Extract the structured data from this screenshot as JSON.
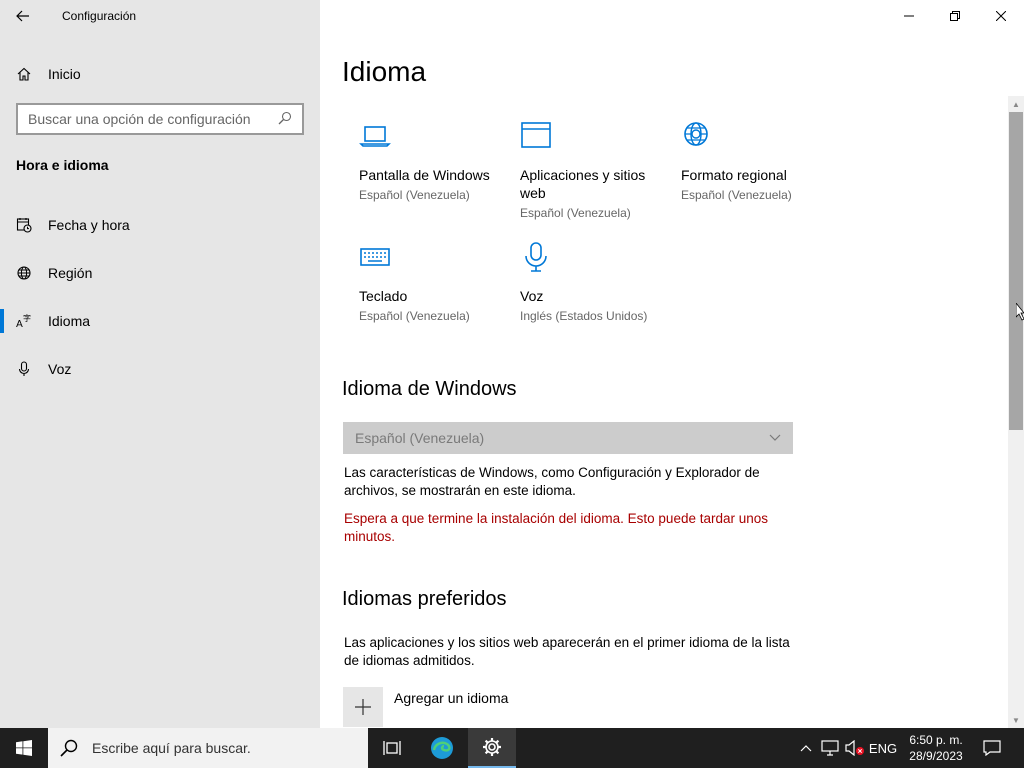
{
  "window": {
    "title": "Configuración",
    "controls": {
      "minimize": "—",
      "restore": "❐",
      "close": "✕"
    }
  },
  "sidebar": {
    "home_label": "Inicio",
    "search_placeholder": "Buscar una opción de configuración",
    "section_title": "Hora e idioma",
    "items": [
      {
        "label": "Fecha y hora",
        "icon": "calendar-clock-icon",
        "selected": false
      },
      {
        "label": "Región",
        "icon": "globe-icon",
        "selected": false
      },
      {
        "label": "Idioma",
        "icon": "language-icon",
        "selected": true
      },
      {
        "label": "Voz",
        "icon": "microphone-icon",
        "selected": false
      }
    ]
  },
  "main": {
    "title": "Idioma",
    "tiles": [
      {
        "title": "Pantalla de Windows",
        "subtitle": "Español (Venezuela)",
        "icon": "laptop-icon"
      },
      {
        "title": "Aplicaciones y sitios web",
        "subtitle": "Español (Venezuela)",
        "icon": "app-window-icon"
      },
      {
        "title": "Formato regional",
        "subtitle": "Español (Venezuela)",
        "icon": "globe-gear-icon"
      },
      {
        "title": "Teclado",
        "subtitle": "Español (Venezuela)",
        "icon": "keyboard-icon"
      },
      {
        "title": "Voz",
        "subtitle": "Inglés (Estados Unidos)",
        "icon": "microphone-icon"
      }
    ],
    "windows_language": {
      "heading": "Idioma de Windows",
      "dropdown_value": "Español (Venezuela)",
      "description": "Las características de Windows, como Configuración y Explorador de archivos, se mostrarán en este idioma.",
      "warning": "Espera a que termine la instalación del idioma. Esto puede tardar unos minutos."
    },
    "preferred": {
      "heading": "Idiomas preferidos",
      "description": "Las aplicaciones y los sitios web aparecerán en el primer idioma de la lista de idiomas admitidos.",
      "add_label": "Agregar un idioma"
    }
  },
  "taskbar": {
    "search_placeholder": "Escribe aquí para buscar.",
    "language": "ENG",
    "time": "6:50 p. m.",
    "date": "28/9/2023"
  },
  "colors": {
    "accent": "#0078d7",
    "warning": "#a80000",
    "sidebar_bg": "#e6e6e6",
    "taskbar_bg": "#1f1f1f"
  }
}
